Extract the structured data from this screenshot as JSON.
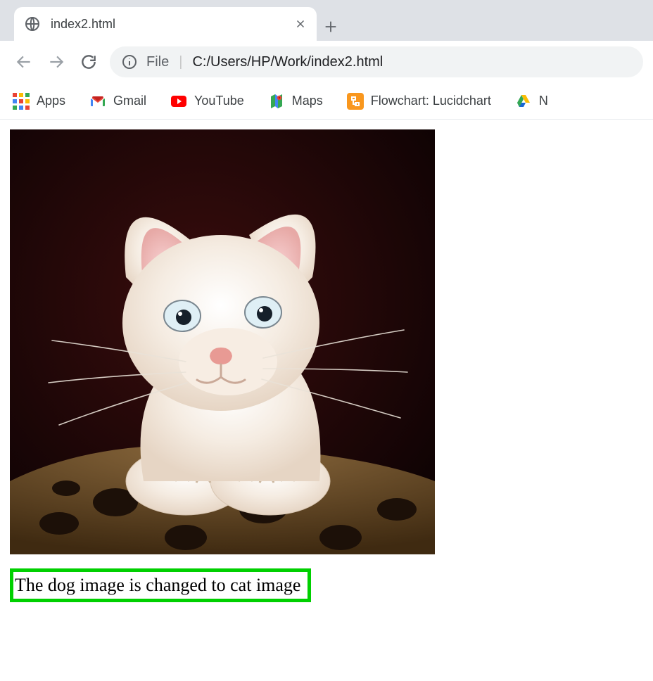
{
  "tab": {
    "title": "index2.html"
  },
  "omnibox": {
    "file_label": "File",
    "path": "C:/Users/HP/Work/index2.html"
  },
  "bookmarks": {
    "apps": "Apps",
    "gmail": "Gmail",
    "youtube": "YouTube",
    "maps": "Maps",
    "lucidchart": "Flowchart: Lucidchart",
    "drive": "N"
  },
  "page": {
    "image_alt": "kitten",
    "caption": "The dog image is changed to cat image"
  }
}
